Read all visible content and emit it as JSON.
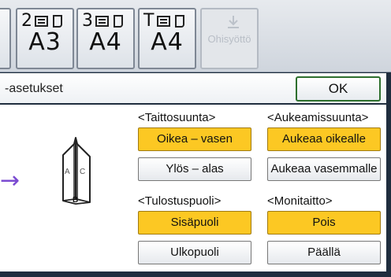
{
  "trays": [
    {
      "num": "2",
      "size": "A3"
    },
    {
      "num": "3",
      "size": "A4"
    },
    {
      "num": "T",
      "size": "A4"
    }
  ],
  "bypass_label": "Ohisyöttö",
  "header": {
    "title": "-asetukset",
    "ok_label": "OK"
  },
  "sections": {
    "taittosuunta": {
      "label": "<Taittosuunta>",
      "options": [
        "Oikea – vasen",
        "Ylös – alas"
      ],
      "selected": "Oikea – vasen"
    },
    "aukeamissuunta": {
      "label": "<Aukeamissuunta>",
      "options": [
        "Aukeaa oikealle",
        "Aukeaa vasemmalle"
      ],
      "selected": "Aukeaa oikealle"
    },
    "tulostuspuoli": {
      "label": "<Tulostuspuoli>",
      "options": [
        "Sisäpuoli",
        "Ulkopuoli"
      ],
      "selected": "Sisäpuoli"
    },
    "monitaitto": {
      "label": "<Monitaitto>",
      "options": [
        "Pois",
        "Päällä"
      ],
      "selected": "Pois"
    }
  },
  "illustration": {
    "letters": [
      "A",
      "C",
      "B"
    ]
  },
  "colors": {
    "selected": "#fcc823",
    "frame": "#1f2d3e",
    "ok_border": "#2d6f2d",
    "arrow": "#7b4bd1"
  }
}
